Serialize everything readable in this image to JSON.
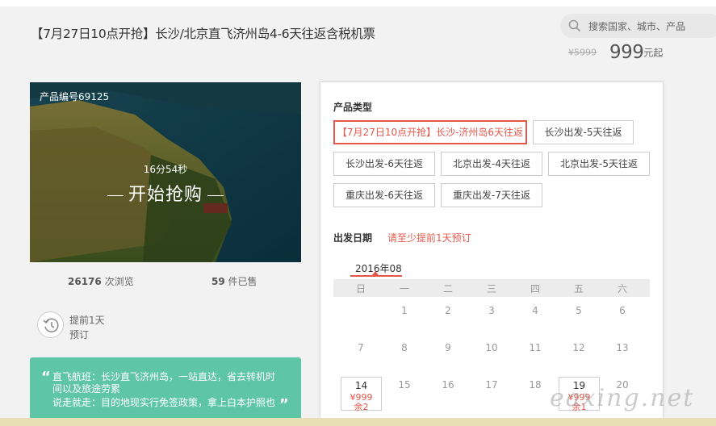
{
  "title": "【7月27日10点开抢】长沙/北京直飞济州岛4-6天往返含税机票",
  "search": {
    "placeholder": "搜索国家、城市、产品",
    "icon": "search-icon"
  },
  "price": {
    "original": "¥5999",
    "current": "999",
    "unit": "元起"
  },
  "hero": {
    "product_code": "产品编号69125",
    "countdown": "16分54秒",
    "buy_label": "开始抢购"
  },
  "stats": {
    "views_count": "26176",
    "views_label": "次浏览",
    "sold_count": "59",
    "sold_label": "件已售"
  },
  "advance": {
    "line1": "提前1天",
    "line2": "预订"
  },
  "highlights": [
    "直飞航班：长沙直飞济州岛，一站直达，省去转机时",
    "间以及旅途劳累",
    "说走就走：目的地现实行免签政策，拿上白本护照也"
  ],
  "options": {
    "heading": "产品类型",
    "items": [
      "【7月27日10点开抢】长沙-济州岛6天往返",
      "长沙出发-5天往返",
      "长沙出发-6天往返",
      "北京出发-4天往返",
      "北京出发-5天往返",
      "重庆出发-6天往返",
      "重庆出发-7天往返"
    ],
    "selected_index": 0
  },
  "date": {
    "heading": "出发日期",
    "hint": "请至少提前1天预订",
    "month": "2016年08",
    "weekdays": [
      "日",
      "一",
      "二",
      "三",
      "四",
      "五",
      "六"
    ],
    "row1": [
      "1",
      "2",
      "3",
      "4",
      "5",
      "6"
    ],
    "row2": [
      "7",
      "8",
      "9",
      "10",
      "11",
      "12",
      "13"
    ],
    "row3": [
      {
        "day": "14",
        "price": "¥999",
        "stock": "余2",
        "available": true
      },
      {
        "day": "15"
      },
      {
        "day": "16"
      },
      {
        "day": "17"
      },
      {
        "day": "18"
      },
      {
        "day": "19",
        "price": "¥999",
        "stock": "余1",
        "available": true
      },
      {
        "day": "20"
      }
    ]
  },
  "watermark": "eaxing.net",
  "colors": {
    "accent": "#e5564a",
    "green_box": "#5ec6a7"
  }
}
